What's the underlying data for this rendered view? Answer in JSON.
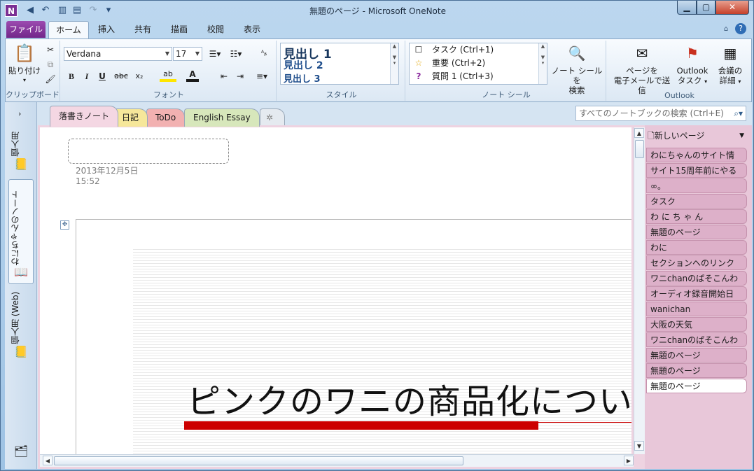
{
  "window": {
    "title": "無題のページ - Microsoft OneNote",
    "app_icon_letter": "N",
    "minimize": "▁",
    "maximize": "▢",
    "close": "✕"
  },
  "qat": {
    "icons": [
      "back-icon",
      "undo-icon",
      "dock-icon",
      "page-view-icon",
      "redo-icon",
      "customize-icon"
    ]
  },
  "ribbon_tabs": {
    "file": "ファイル",
    "home": "ホーム",
    "insert": "挿入",
    "share": "共有",
    "draw": "描画",
    "review": "校閲",
    "view": "表示"
  },
  "clipboard": {
    "paste": "貼り付け",
    "label": "クリップボード"
  },
  "font": {
    "name": "Verdana",
    "size": "17",
    "label": "フォント",
    "bold": "B",
    "italic": "I",
    "underline": "U",
    "strike": "abc",
    "subscript": "x₂",
    "highlight": "ab",
    "font_color": "A"
  },
  "styles": {
    "h1": "見出し 1",
    "h2": "見出し 2",
    "h3": "見出し 3",
    "label": "スタイル"
  },
  "tags": {
    "task": "タスク (Ctrl+1)",
    "important": "重要 (Ctrl+2)",
    "question": "質問 1 (Ctrl+3)",
    "label": "ノート シール",
    "find_line1": "ノート シールを",
    "find_line2": "検索"
  },
  "outlook": {
    "email_line1": "ページを",
    "email_line2": "電子メールで送信",
    "task_line1": "Outlook",
    "task_line2": "タスク",
    "meeting_line1": "会議の",
    "meeting_line2": "詳細",
    "label": "Outlook"
  },
  "nav": {
    "nb1": "個人用",
    "nb2": "わにちゃんのノート",
    "nb3": "個人用 (Web)"
  },
  "section_tabs": [
    "落書きノート",
    "日記",
    "ToDo",
    "English Essay"
  ],
  "section_colors": [
    "#f4d7e3",
    "#f6e79a",
    "#f2b1b1",
    "#d7e7bb"
  ],
  "search": {
    "placeholder": "すべてのノートブックの検索 (Ctrl+E)"
  },
  "page": {
    "date": "2013年12月5日",
    "time": "15:52",
    "heading": "ピンクのワニの商品化について"
  },
  "pages_pane": {
    "new_page": "新しいページ",
    "pages": [
      "わにちゃんのサイト情",
      "サイト15周年前にやる",
      "∞。",
      "タスク",
      "わ に ち ゃ ん",
      "無題のページ",
      "わに",
      "セクションへのリンク",
      "ワニchanのぱそこんわ",
      "オーディオ録音開始日",
      "wanichan",
      "大阪の天気",
      "ワニchanのぱそこんわ",
      "無題のページ",
      "無題のページ",
      "無題のページ"
    ],
    "active_index": 15
  },
  "colors": {
    "accent_file": "#7b2f94",
    "red_bar": "#cc0000"
  }
}
